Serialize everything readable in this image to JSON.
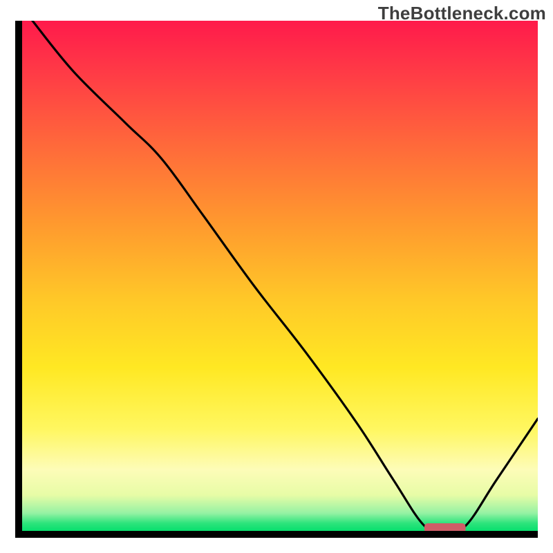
{
  "watermark": "TheBottleneck.com",
  "chart_data": {
    "type": "line",
    "title": "",
    "xlabel": "",
    "ylabel": "",
    "xlim": [
      0,
      100
    ],
    "ylim": [
      0,
      100
    ],
    "grid": false,
    "legend": false,
    "annotations": [],
    "marker": {
      "x_range": [
        78,
        86
      ],
      "y": 0,
      "color": "#cf5d67"
    },
    "series": [
      {
        "name": "curve",
        "x": [
          2,
          10,
          20,
          27,
          35,
          45,
          55,
          65,
          72,
          78,
          82,
          86,
          92,
          100
        ],
        "y": [
          100,
          90,
          80,
          73,
          62,
          48,
          35,
          21,
          10,
          1,
          0,
          1,
          10,
          22
        ]
      }
    ],
    "gradient_stops": [
      {
        "offset": 0.0,
        "color": "#ff1a4b"
      },
      {
        "offset": 0.1,
        "color": "#ff3a46"
      },
      {
        "offset": 0.25,
        "color": "#ff6b3a"
      },
      {
        "offset": 0.4,
        "color": "#ff9a2e"
      },
      {
        "offset": 0.55,
        "color": "#ffc928"
      },
      {
        "offset": 0.68,
        "color": "#ffe823"
      },
      {
        "offset": 0.8,
        "color": "#fff760"
      },
      {
        "offset": 0.88,
        "color": "#fdfcb8"
      },
      {
        "offset": 0.93,
        "color": "#e7fca6"
      },
      {
        "offset": 0.965,
        "color": "#96f2a4"
      },
      {
        "offset": 0.985,
        "color": "#2de47c"
      },
      {
        "offset": 1.0,
        "color": "#07df6d"
      }
    ]
  }
}
